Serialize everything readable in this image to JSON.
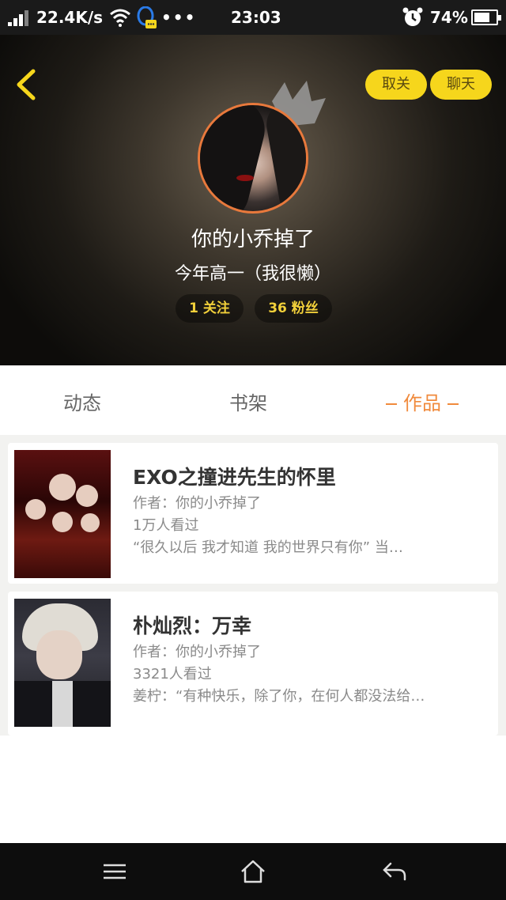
{
  "status_bar": {
    "speed": "22.4K/s",
    "dots": "•••",
    "time": "23:03",
    "battery": "74%",
    "battery_level": 0.74,
    "icons": [
      "signal-icon",
      "wifi-icon",
      "qq-notification-icon",
      "alarm-icon",
      "battery-icon"
    ]
  },
  "header": {
    "back_icon": "chevron-left-icon",
    "unfollow_label": "取关",
    "chat_label": "聊天",
    "username": "你的小乔掉了",
    "bio": "今年高一（我很懒）",
    "following": "1 关注",
    "followers": "36 粉丝",
    "colors": {
      "accent": "#f6d61c",
      "avatar_ring": "#e8793c",
      "stat_text": "#f2d03a"
    }
  },
  "tabs": [
    {
      "label": "动态",
      "active": false
    },
    {
      "label": "书架",
      "active": false
    },
    {
      "label": "作品",
      "active": true
    }
  ],
  "works": [
    {
      "title": "EXO之撞进先生的怀里",
      "author": "作者：你的小乔掉了",
      "views": "1万人看过",
      "description": "“很久以后 我才知道 我的世界只有你” 当…"
    },
    {
      "title": "朴灿烈：万幸",
      "author": "作者：你的小乔掉了",
      "views": "3321人看过",
      "description": "姜柠：“有种快乐，除了你，在何人都没法给…"
    }
  ],
  "navbar": {
    "items": [
      "menu-icon",
      "home-icon",
      "back-icon"
    ]
  }
}
